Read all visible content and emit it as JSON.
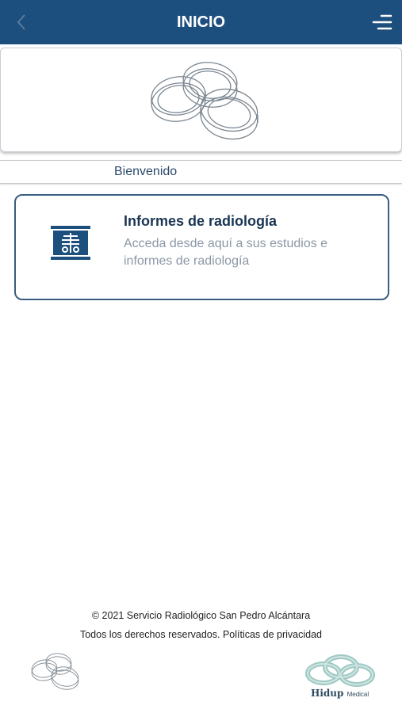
{
  "header": {
    "title": "INICIO"
  },
  "welcome": {
    "text": "Bienvenido"
  },
  "module": {
    "title": "Informes de radiología",
    "description": "Acceda desde aquí a sus estudios e informes de radiología",
    "icon": "xray-report-icon"
  },
  "footer": {
    "copyright": "© 2021 Servicio Radiológico San Pedro Alcántara",
    "rights": "Todos los derechos reservados.",
    "privacy_link": "Políticas de privacidad",
    "brand": "Hidup",
    "brand_sub": "Medical"
  },
  "colors": {
    "header_bg": "#1d4f7e",
    "accent": "#3a5d82",
    "brand_teal": "#9fc9c4"
  }
}
